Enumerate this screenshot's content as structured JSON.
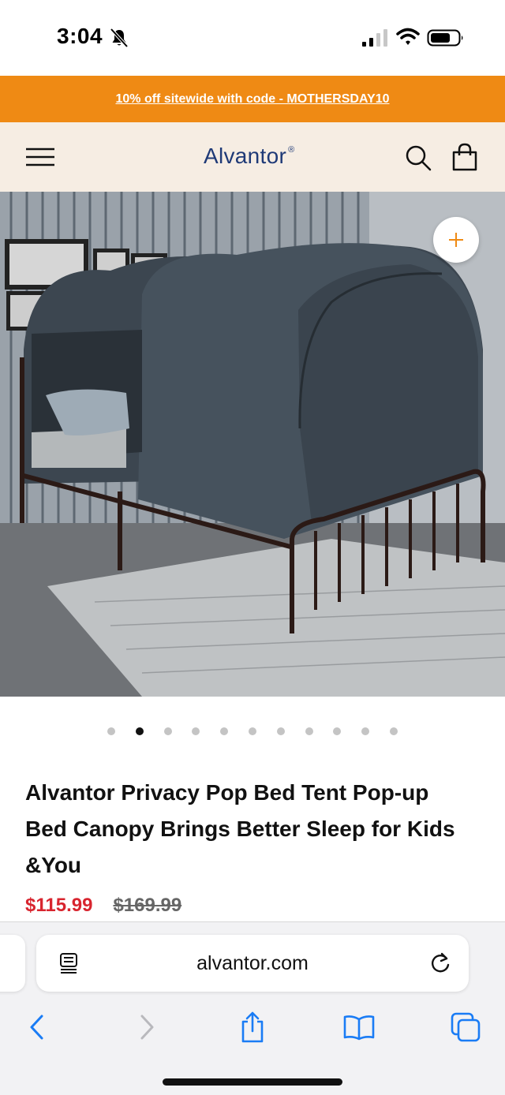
{
  "status_bar": {
    "time": "3:04",
    "icons": [
      "bell-slash-icon",
      "signal-icon",
      "wifi-icon",
      "battery-icon"
    ]
  },
  "promo_banner": {
    "text": "10% off sitewide with code - MOTHERSDAY10",
    "background": "#ef8a14"
  },
  "header": {
    "brand": "Alvantor",
    "brand_mark": "®",
    "icons": [
      "menu-icon",
      "search-icon",
      "shopping-bag-icon"
    ],
    "brand_color": "#1f3a77",
    "background": "#f6ede3"
  },
  "product": {
    "image_icon": "product-photo-bed-tent",
    "zoom_icon": "plus-icon",
    "gallery": {
      "total": 11,
      "active_index": 1
    },
    "title": "Alvantor Privacy Pop Bed Tent Pop-up Bed Canopy Brings Better Sleep for Kids &You",
    "sale_price": "$115.99",
    "original_price": "$169.99",
    "sale_color": "#d8252f"
  },
  "browser": {
    "url": "alvantor.com",
    "icons": [
      "reader-mode-icon",
      "reload-icon",
      "back-icon",
      "forward-icon",
      "share-icon",
      "bookmarks-icon",
      "tabs-icon"
    ],
    "accent": "#1a7cf5"
  }
}
